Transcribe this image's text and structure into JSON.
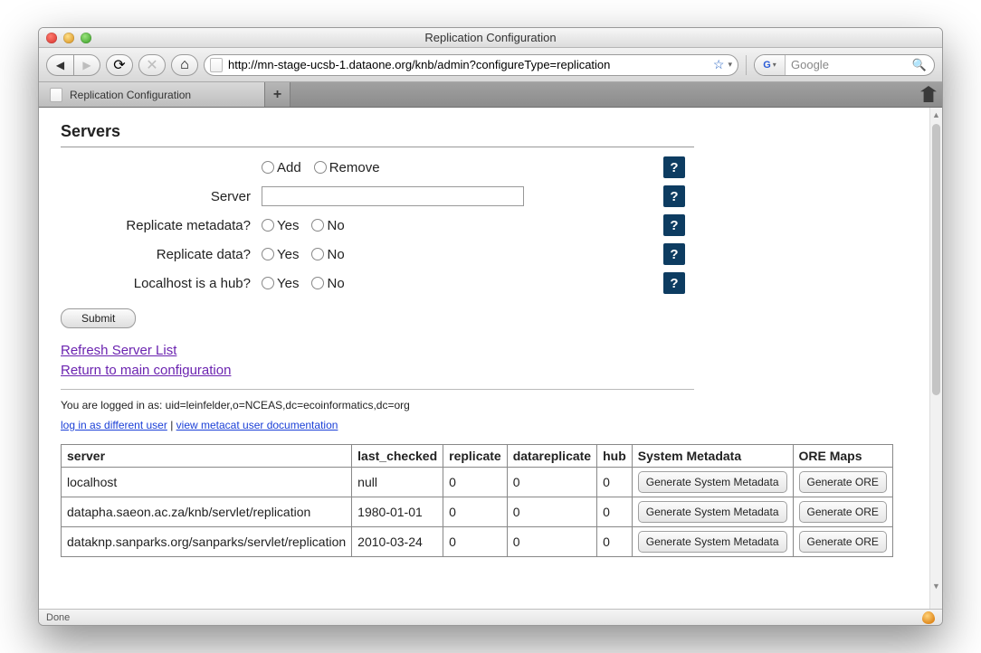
{
  "window": {
    "title": "Replication Configuration"
  },
  "toolbar": {
    "url": "http://mn-stage-ucsb-1.dataone.org/knb/admin?configureType=replication",
    "search_placeholder": "Google"
  },
  "tabs": {
    "active": "Replication Configuration"
  },
  "page": {
    "heading": "Servers",
    "form": {
      "action": {
        "add": "Add",
        "remove": "Remove"
      },
      "server_label": "Server",
      "repl_meta_label": "Replicate metadata?",
      "repl_data_label": "Replicate data?",
      "hub_label": "Localhost is a hub?",
      "yes": "Yes",
      "no": "No",
      "submit": "Submit",
      "help": "?"
    },
    "links": {
      "refresh": "Refresh Server List",
      "return": "Return to main configuration",
      "login_as_other": "log in as different user",
      "docs": "view metacat user documentation"
    },
    "logged_in_prefix": "You are logged in as: ",
    "logged_in_dn": "uid=leinfelder,o=NCEAS,dc=ecoinformatics,dc=org",
    "table": {
      "headers": {
        "server": "server",
        "last_checked": "last_checked",
        "replicate": "replicate",
        "datareplicate": "datareplicate",
        "hub": "hub",
        "sysmeta": "System Metadata",
        "ore": "ORE Maps"
      },
      "buttons": {
        "gen_sysmeta": "Generate System Metadata",
        "gen_ore": "Generate ORE"
      },
      "rows": [
        {
          "server": "localhost",
          "last_checked": "null",
          "replicate": "0",
          "datareplicate": "0",
          "hub": "0"
        },
        {
          "server": "datapha.saeon.ac.za/knb/servlet/replication",
          "last_checked": "1980-01-01",
          "replicate": "0",
          "datareplicate": "0",
          "hub": "0"
        },
        {
          "server": "dataknp.sanparks.org/sanparks/servlet/replication",
          "last_checked": "2010-03-24",
          "replicate": "0",
          "datareplicate": "0",
          "hub": "0"
        }
      ]
    }
  },
  "statusbar": {
    "text": "Done"
  }
}
